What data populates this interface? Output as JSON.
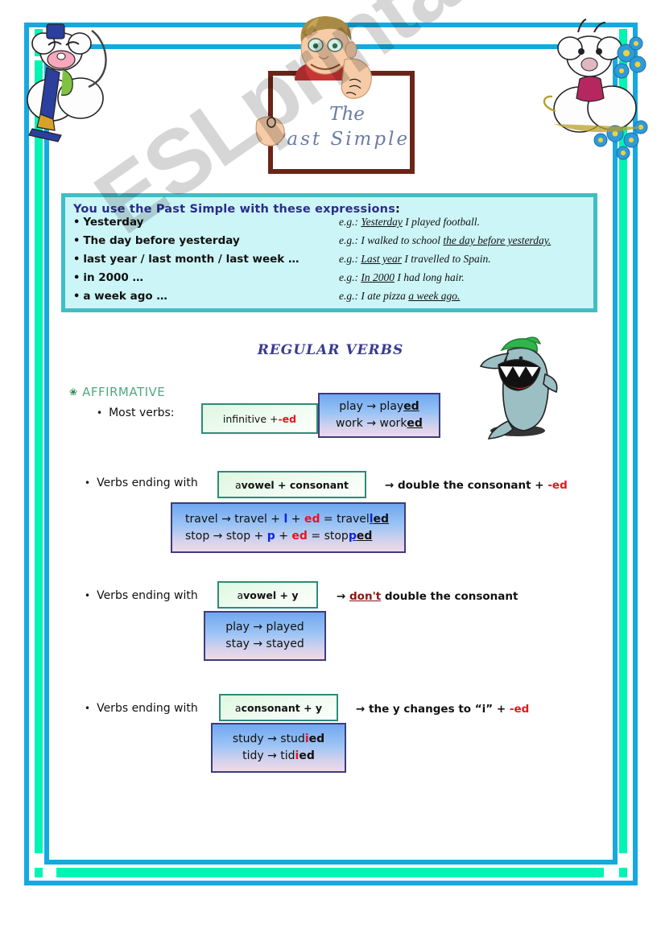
{
  "watermark": "ESLprintables.com",
  "title": {
    "line1": "The",
    "line2": "Past  Simple"
  },
  "expressions": {
    "heading": "You use the Past Simple with these expressions",
    "heading_colon": ":",
    "rows": [
      {
        "term": "Yesterday",
        "eg_prefix": "e.g.: ",
        "eg_pre": "",
        "eg_underline": "Yesterday",
        "eg_post": " I played football."
      },
      {
        "term": "The day before yesterday",
        "eg_prefix": "e.g.: ",
        "eg_pre": "I walked to school ",
        "eg_underline": "the day before    yesterday.",
        "eg_post": ""
      },
      {
        "term": "last year / last month / last week …",
        "eg_prefix": "e.g.: ",
        "eg_pre": "",
        "eg_underline": "Last year",
        "eg_post": " I travelled to Spain."
      },
      {
        "term": "in 2000 …",
        "eg_prefix": "e.g.: ",
        "eg_pre": "",
        "eg_underline": "In 2000",
        "eg_post": " I had long hair."
      },
      {
        "term": "a week ago …",
        "eg_prefix": "e.g.: ",
        "eg_pre": "I ate pizza ",
        "eg_underline": "a week ago.",
        "eg_post": ""
      }
    ]
  },
  "section": {
    "regular_verbs_heading": "REGULAR VERBS",
    "affirmative_label": "AFFIRMATIVE",
    "affirmative_marker": "❀"
  },
  "rules": [
    {
      "label": "Most verbs:",
      "bullet": "•",
      "box_text_plain": "infinitive + ",
      "box_text_red": "-ed",
      "examples_line1_a": "play → play",
      "examples_line1_u": "ed",
      "examples_line2_a": "work  → work",
      "examples_line2_u": "ed"
    },
    {
      "label": "Verbs ending with",
      "bullet": "•",
      "box_prefix": "a ",
      "box_bold": "vowel + consonant",
      "arrow_text": "→ double the consonant + ",
      "arrow_red": "-ed",
      "ex1_p1": "travel → travel + ",
      "ex1_blue": "l",
      "ex1_p2": " + ",
      "ex1_red": "ed",
      "ex1_p3": " = travel",
      "ex1_u_blue": "l",
      "ex1_u_black": "ed",
      "ex2_p1": "stop → stop + ",
      "ex2_blue": "p",
      "ex2_p2": " + ",
      "ex2_red": "ed",
      "ex2_p3": " = stop",
      "ex2_u_blue": "p",
      "ex2_u_black": "ed"
    },
    {
      "label": "Verbs ending with",
      "bullet": "•",
      "box_prefix": "a ",
      "box_bold": "vowel + y",
      "arrow_pre": "→ ",
      "arrow_dont": "don't",
      "arrow_post": " double the consonant",
      "ex1": "play → played",
      "ex2": "stay → stayed"
    },
    {
      "label": "Verbs ending with",
      "bullet": "•",
      "box_prefix": "a ",
      "box_bold": "consonant  + y",
      "arrow_text": "→ the y changes to “i” + ",
      "arrow_red": "-ed",
      "ex1_p1": "study → stud",
      "ex1_red": "i",
      "ex1_p2": "ed",
      "ex2_p1": "tidy → tid",
      "ex2_red": "i",
      "ex2_p2": "ed"
    }
  ],
  "colors": {
    "frame_blue": "#16A9E0",
    "frame_green": "#00F5B4",
    "expr_box_bg": "#CCF5F7",
    "expr_box_border": "#3FBFC4",
    "heading_navy": "#2B2B8C",
    "regular_verbs_purple": "#3B3B8F",
    "affirmative_green": "#4FA882",
    "red_accent": "#E8141E",
    "blue_accent": "#0A27D8",
    "dark_red": "#8C1414",
    "board_border": "#6B2418"
  }
}
